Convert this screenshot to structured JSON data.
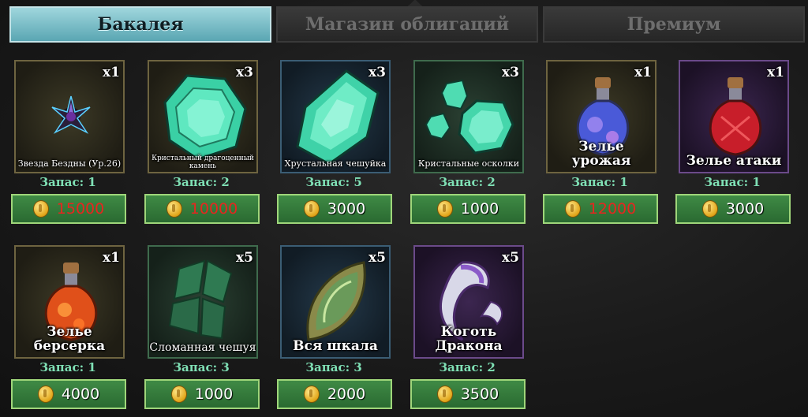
{
  "tabs": [
    {
      "label": "Бакалея",
      "active": true
    },
    {
      "label": "Магазин облигаций",
      "active": false
    },
    {
      "label": "Премиум",
      "active": false
    }
  ],
  "stock_prefix": "Запас:",
  "items": [
    {
      "name": "Звезда Бездны (Ур.26)",
      "qty": "x1",
      "stock": "Запас: 1",
      "price": "15000",
      "price_red": true,
      "frame": "gold",
      "icon": "abyss-star-icon"
    },
    {
      "name": "Кристальный драгоценный камень",
      "qty": "x3",
      "stock": "Запас: 2",
      "price": "10000",
      "price_red": true,
      "frame": "gold",
      "icon": "crystal-gem-icon"
    },
    {
      "name": "Хрустальная чешуйка",
      "qty": "x3",
      "stock": "Запас: 5",
      "price": "3000",
      "price_red": false,
      "frame": "blue",
      "icon": "crystal-scale-icon"
    },
    {
      "name": "Кристальные осколки",
      "qty": "x3",
      "stock": "Запас: 2",
      "price": "1000",
      "price_red": false,
      "frame": "green",
      "icon": "crystal-shards-icon"
    },
    {
      "name": "Зелье урожая",
      "qty": "x1",
      "stock": "Запас: 1",
      "price": "12000",
      "price_red": true,
      "frame": "gold",
      "icon": "harvest-potion-icon"
    },
    {
      "name": "Зелье атаки",
      "qty": "x1",
      "stock": "Запас: 1",
      "price": "3000",
      "price_red": false,
      "frame": "purple",
      "icon": "attack-potion-icon"
    },
    {
      "name": "Зелье берсерка",
      "qty": "x1",
      "stock": "Запас: 1",
      "price": "4000",
      "price_red": false,
      "frame": "gold",
      "icon": "berserk-potion-icon"
    },
    {
      "name": "Сломанная чешуя",
      "qty": "x5",
      "stock": "Запас: 3",
      "price": "1000",
      "price_red": false,
      "frame": "green",
      "icon": "broken-scale-icon"
    },
    {
      "name": "Вся шкала",
      "qty": "x5",
      "stock": "Запас: 3",
      "price": "2000",
      "price_red": false,
      "frame": "blue",
      "icon": "whole-scale-icon"
    },
    {
      "name": "Коготь Дракона",
      "qty": "x5",
      "stock": "Запас: 2",
      "price": "3500",
      "price_red": false,
      "frame": "purple",
      "icon": "dragon-claw-icon"
    }
  ],
  "colors": {
    "active_tab": "#7fc3cd",
    "stock_text": "#7fe0b5",
    "buy_button": "#3a7f40",
    "price_unaffordable": "#e8251f"
  }
}
